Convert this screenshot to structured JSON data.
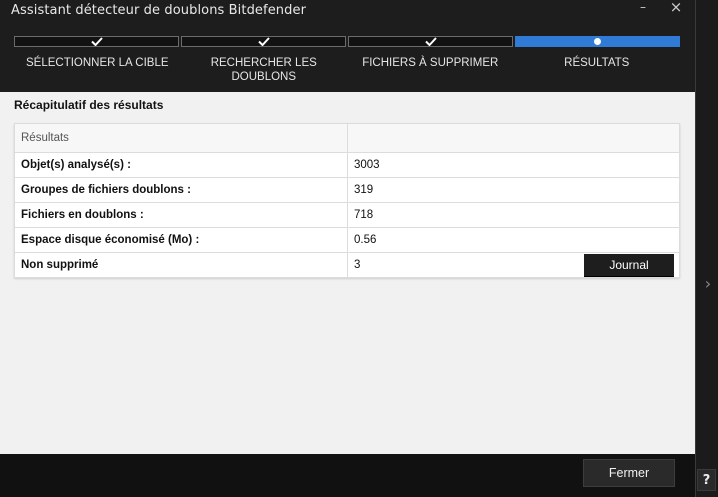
{
  "window": {
    "title": "Assistant détecteur de doublons Bitdefender",
    "minimize_glyph": "–",
    "close_glyph": "×"
  },
  "wizard": {
    "steps": [
      {
        "label": "SÉLECTIONNER LA CIBLE",
        "status": "completed",
        "icon": "check-icon"
      },
      {
        "label": "RECHERCHER LES DOUBLONS",
        "status": "completed",
        "icon": "check-icon"
      },
      {
        "label": "FICHIERS À SUPPRIMER",
        "status": "completed",
        "icon": "check-icon"
      },
      {
        "label": "RÉSULTATS",
        "status": "current",
        "icon": "current-step-dot-icon"
      }
    ],
    "accent_color": "#2f7bd6"
  },
  "summary": {
    "title": "Récapitulatif des résultats",
    "header": "Résultats",
    "rows": [
      {
        "label": "Objet(s) analysé(s) :",
        "value": "3003"
      },
      {
        "label": "Groupes de fichiers doublons :",
        "value": "319"
      },
      {
        "label": "Fichiers en doublons :",
        "value": "718"
      },
      {
        "label": "Espace disque économisé (Mo) :",
        "value": "0.56"
      },
      {
        "label": "Non supprimé",
        "value": "3"
      }
    ],
    "journal_button": "Journal"
  },
  "footer": {
    "close_button": "Fermer"
  },
  "side": {
    "expand_glyph": "›",
    "help_glyph": "?"
  }
}
